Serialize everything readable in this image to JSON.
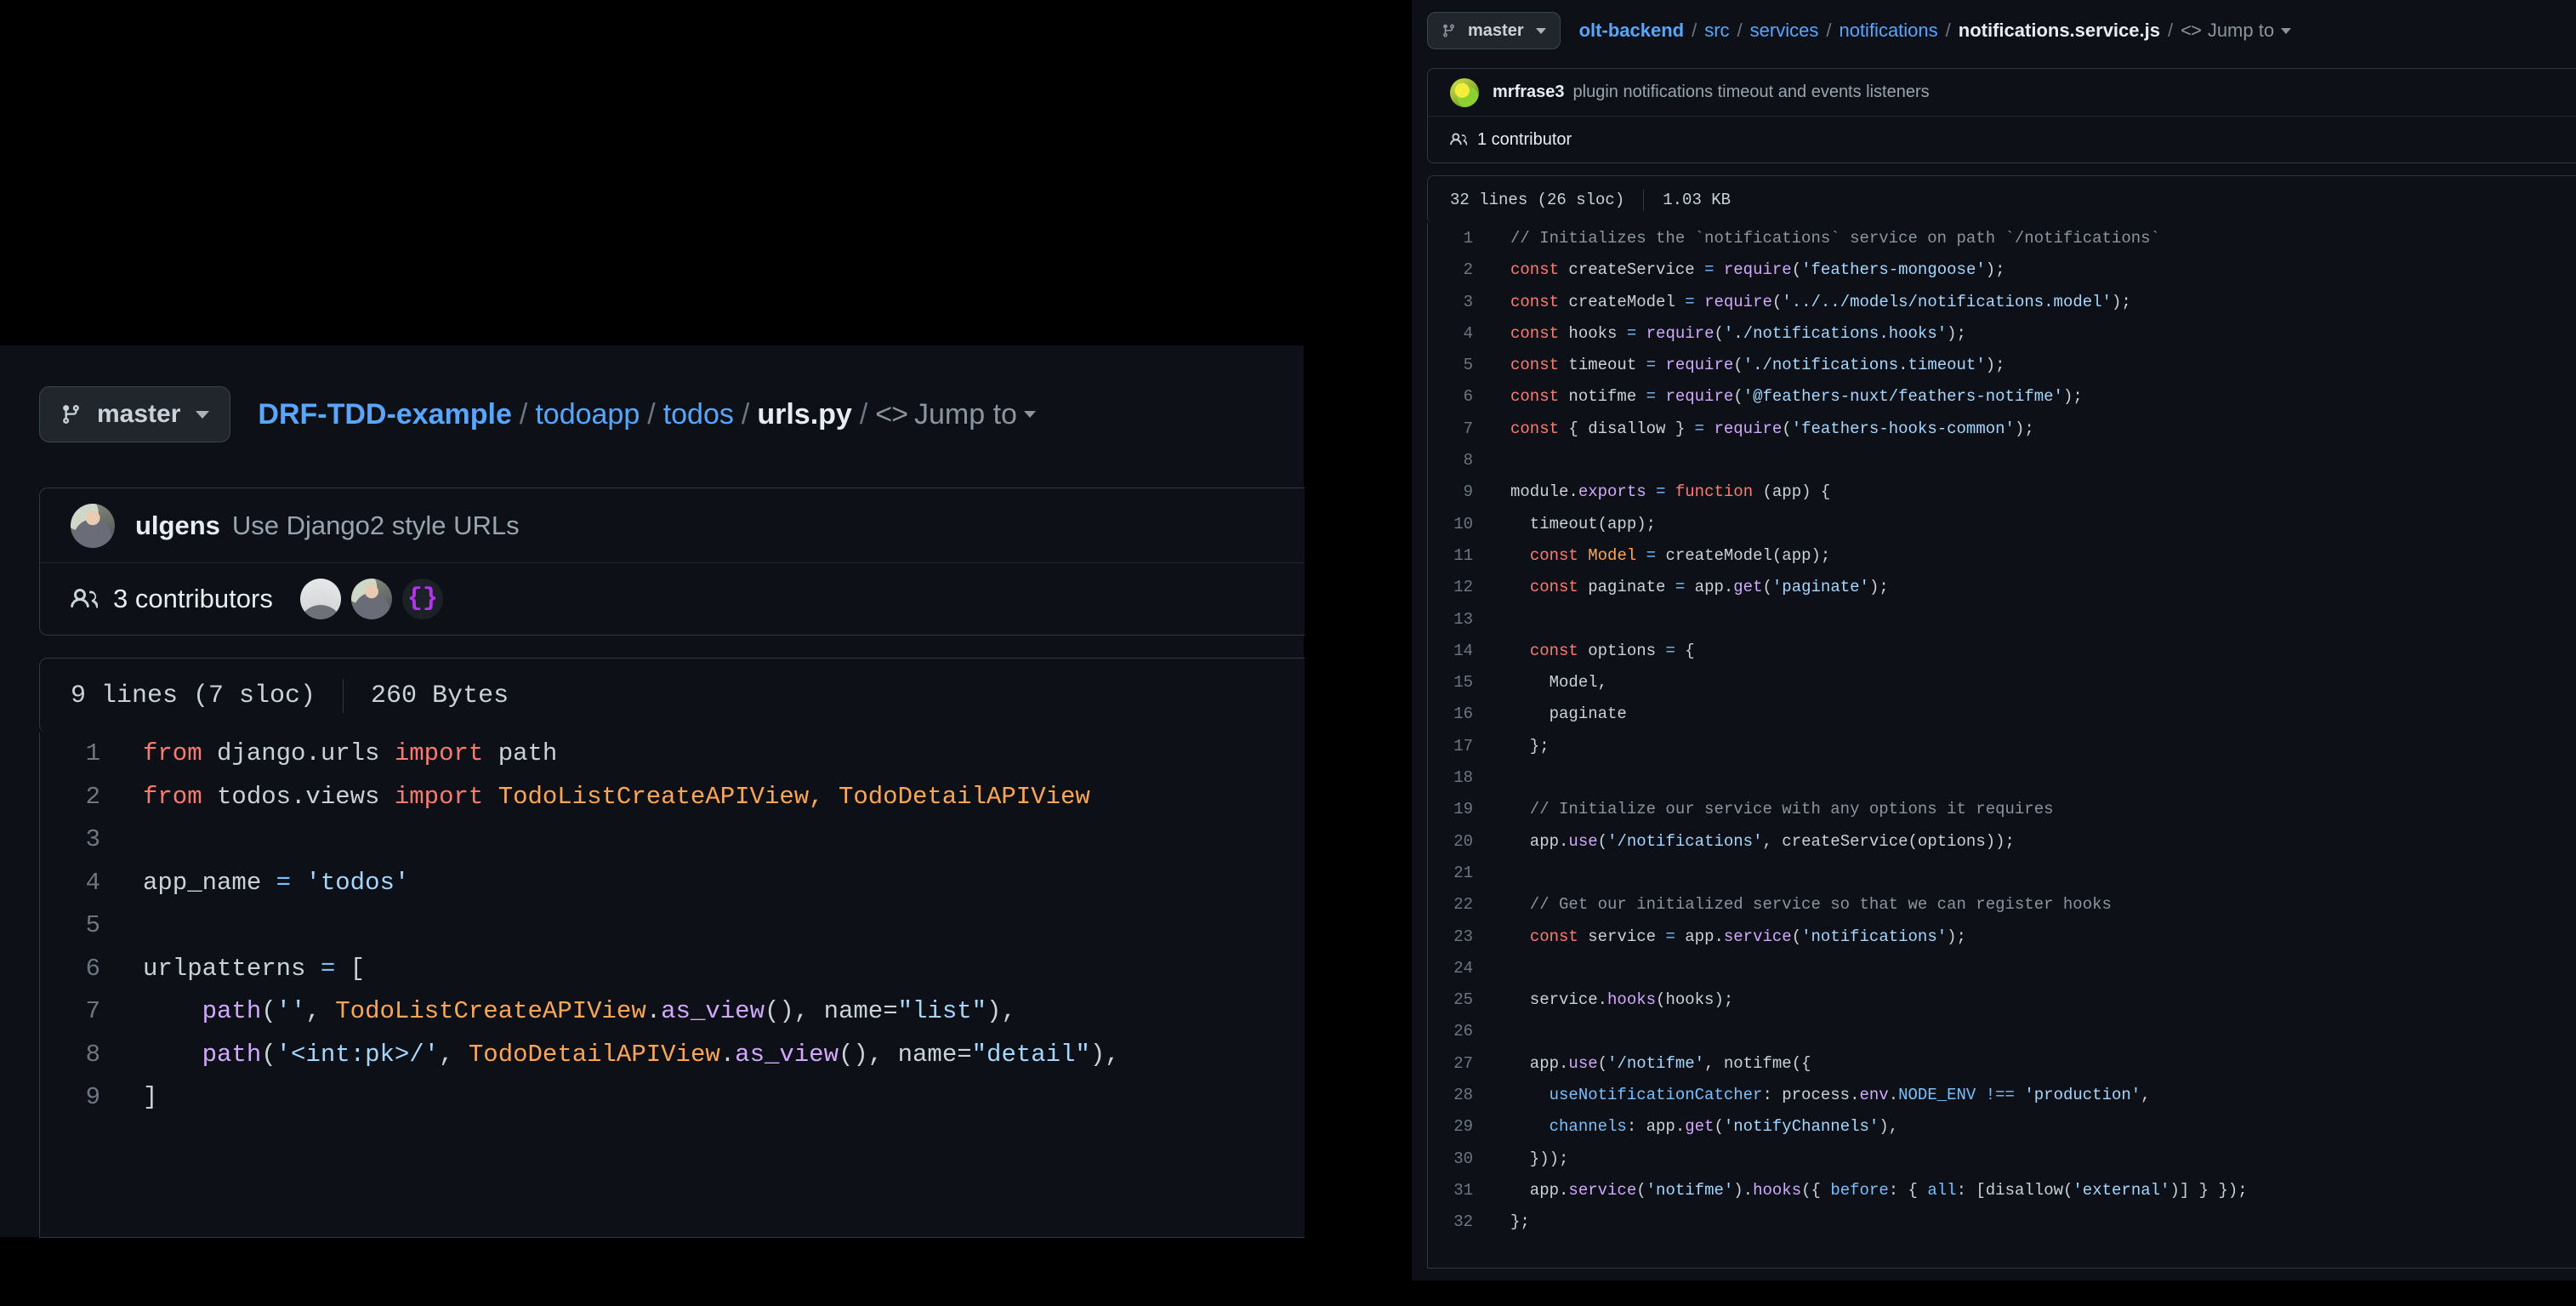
{
  "left_panel": {
    "branch": {
      "label": "master",
      "icon": "git-branch-icon",
      "caret": "▾"
    },
    "breadcrumb": {
      "segments": [
        "DRF-TDD-example",
        "todoapp",
        "todos"
      ],
      "current": "urls.py",
      "separator": "/",
      "jump_to": "Jump to",
      "code_glyph": "<>"
    },
    "commit": {
      "author": "ulgens",
      "message": "Use Django2 style URLs",
      "avatar": "user-avatar-photo"
    },
    "contributors": {
      "count_text": "3 contributors",
      "icon": "people-icon",
      "avatars": [
        "silhouette-avatar",
        "photo-avatar",
        "braces-avatar"
      ],
      "braces_glyph": "{}"
    },
    "file_meta": {
      "lines": "9 lines (7 sloc)",
      "size": "260 Bytes"
    },
    "code": {
      "language": "python",
      "lines": [
        {
          "n": "1",
          "tokens": [
            {
              "t": "from ",
              "c": "t-kw"
            },
            {
              "t": "django.urls ",
              "c": "t-pln"
            },
            {
              "t": "import ",
              "c": "t-kw"
            },
            {
              "t": "path",
              "c": "t-pln"
            }
          ]
        },
        {
          "n": "2",
          "tokens": [
            {
              "t": "from ",
              "c": "t-kw"
            },
            {
              "t": "todos.views ",
              "c": "t-pln"
            },
            {
              "t": "import ",
              "c": "t-kw"
            },
            {
              "t": "TodoListCreateAPIView, TodoDetailAPIView",
              "c": "t-cls"
            }
          ]
        },
        {
          "n": "3",
          "tokens": []
        },
        {
          "n": "4",
          "tokens": [
            {
              "t": "app_name ",
              "c": "t-pln"
            },
            {
              "t": "=",
              "c": "t-op"
            },
            {
              "t": " ",
              "c": "t-pln"
            },
            {
              "t": "'todos'",
              "c": "t-str"
            }
          ]
        },
        {
          "n": "5",
          "tokens": []
        },
        {
          "n": "6",
          "tokens": [
            {
              "t": "urlpatterns ",
              "c": "t-pln"
            },
            {
              "t": "=",
              "c": "t-op"
            },
            {
              "t": " [",
              "c": "t-pln"
            }
          ]
        },
        {
          "n": "7",
          "tokens": [
            {
              "t": "    ",
              "c": "t-pln"
            },
            {
              "t": "path",
              "c": "t-fn"
            },
            {
              "t": "(",
              "c": "t-pln"
            },
            {
              "t": "''",
              "c": "t-str"
            },
            {
              "t": ", ",
              "c": "t-pln"
            },
            {
              "t": "TodoListCreateAPIView",
              "c": "t-cls"
            },
            {
              "t": ".",
              "c": "t-pln"
            },
            {
              "t": "as_view",
              "c": "t-fn"
            },
            {
              "t": "(), name=",
              "c": "t-pln"
            },
            {
              "t": "\"list\"",
              "c": "t-str"
            },
            {
              "t": "),",
              "c": "t-pln"
            }
          ]
        },
        {
          "n": "8",
          "tokens": [
            {
              "t": "    ",
              "c": "t-pln"
            },
            {
              "t": "path",
              "c": "t-fn"
            },
            {
              "t": "(",
              "c": "t-pln"
            },
            {
              "t": "'<int:pk>/'",
              "c": "t-str"
            },
            {
              "t": ", ",
              "c": "t-pln"
            },
            {
              "t": "TodoDetailAPIView",
              "c": "t-cls"
            },
            {
              "t": ".",
              "c": "t-pln"
            },
            {
              "t": "as_view",
              "c": "t-fn"
            },
            {
              "t": "(), name=",
              "c": "t-pln"
            },
            {
              "t": "\"detail\"",
              "c": "t-str"
            },
            {
              "t": "),",
              "c": "t-pln"
            }
          ]
        },
        {
          "n": "9",
          "tokens": [
            {
              "t": "]",
              "c": "t-pln"
            }
          ]
        }
      ]
    }
  },
  "right_panel": {
    "branch": {
      "label": "master",
      "icon": "git-branch-icon",
      "caret": "▾"
    },
    "breadcrumb": {
      "segments": [
        "olt-backend",
        "src",
        "services",
        "notifications"
      ],
      "current": "notifications.service.js",
      "separator": "/",
      "jump_to": "Jump to",
      "code_glyph": "<>"
    },
    "commit": {
      "author": "mrfrase3",
      "message": "plugin notifications timeout and events listeners",
      "avatar": "parrot-avatar"
    },
    "contributors": {
      "count_text": "1 contributor",
      "icon": "people-icon"
    },
    "file_meta": {
      "lines": "32 lines (26 sloc)",
      "size": "1.03 KB"
    },
    "code": {
      "language": "javascript",
      "lines": [
        {
          "n": "1",
          "tokens": [
            {
              "t": "// Initializes the `notifications` service on path `/notifications`",
              "c": "t-cmt"
            }
          ]
        },
        {
          "n": "2",
          "tokens": [
            {
              "t": "const ",
              "c": "t-kw"
            },
            {
              "t": "createService ",
              "c": "t-pln"
            },
            {
              "t": "=",
              "c": "t-op"
            },
            {
              "t": " ",
              "c": "t-pln"
            },
            {
              "t": "require",
              "c": "t-fn"
            },
            {
              "t": "(",
              "c": "t-pln"
            },
            {
              "t": "'feathers-mongoose'",
              "c": "t-str"
            },
            {
              "t": ");",
              "c": "t-pln"
            }
          ]
        },
        {
          "n": "3",
          "tokens": [
            {
              "t": "const ",
              "c": "t-kw"
            },
            {
              "t": "createModel ",
              "c": "t-pln"
            },
            {
              "t": "=",
              "c": "t-op"
            },
            {
              "t": " ",
              "c": "t-pln"
            },
            {
              "t": "require",
              "c": "t-fn"
            },
            {
              "t": "(",
              "c": "t-pln"
            },
            {
              "t": "'../../models/notifications.model'",
              "c": "t-str"
            },
            {
              "t": ");",
              "c": "t-pln"
            }
          ]
        },
        {
          "n": "4",
          "tokens": [
            {
              "t": "const ",
              "c": "t-kw"
            },
            {
              "t": "hooks ",
              "c": "t-pln"
            },
            {
              "t": "=",
              "c": "t-op"
            },
            {
              "t": " ",
              "c": "t-pln"
            },
            {
              "t": "require",
              "c": "t-fn"
            },
            {
              "t": "(",
              "c": "t-pln"
            },
            {
              "t": "'./notifications.hooks'",
              "c": "t-str"
            },
            {
              "t": ");",
              "c": "t-pln"
            }
          ]
        },
        {
          "n": "5",
          "tokens": [
            {
              "t": "const ",
              "c": "t-kw"
            },
            {
              "t": "timeout ",
              "c": "t-pln"
            },
            {
              "t": "=",
              "c": "t-op"
            },
            {
              "t": " ",
              "c": "t-pln"
            },
            {
              "t": "require",
              "c": "t-fn"
            },
            {
              "t": "(",
              "c": "t-pln"
            },
            {
              "t": "'./notifications.timeout'",
              "c": "t-str"
            },
            {
              "t": ");",
              "c": "t-pln"
            }
          ]
        },
        {
          "n": "6",
          "tokens": [
            {
              "t": "const ",
              "c": "t-kw"
            },
            {
              "t": "notifme ",
              "c": "t-pln"
            },
            {
              "t": "=",
              "c": "t-op"
            },
            {
              "t": " ",
              "c": "t-pln"
            },
            {
              "t": "require",
              "c": "t-fn"
            },
            {
              "t": "(",
              "c": "t-pln"
            },
            {
              "t": "'@feathers-nuxt/feathers-notifme'",
              "c": "t-str"
            },
            {
              "t": ");",
              "c": "t-pln"
            }
          ]
        },
        {
          "n": "7",
          "tokens": [
            {
              "t": "const ",
              "c": "t-kw"
            },
            {
              "t": "{ disallow } ",
              "c": "t-pln"
            },
            {
              "t": "=",
              "c": "t-op"
            },
            {
              "t": " ",
              "c": "t-pln"
            },
            {
              "t": "require",
              "c": "t-fn"
            },
            {
              "t": "(",
              "c": "t-pln"
            },
            {
              "t": "'feathers-hooks-common'",
              "c": "t-str"
            },
            {
              "t": ");",
              "c": "t-pln"
            }
          ]
        },
        {
          "n": "8",
          "tokens": []
        },
        {
          "n": "9",
          "tokens": [
            {
              "t": "module.",
              "c": "t-pln"
            },
            {
              "t": "exports",
              "c": "t-fn"
            },
            {
              "t": " ",
              "c": "t-pln"
            },
            {
              "t": "=",
              "c": "t-op"
            },
            {
              "t": " ",
              "c": "t-pln"
            },
            {
              "t": "function",
              "c": "t-kw"
            },
            {
              "t": " (app) {",
              "c": "t-pln"
            }
          ]
        },
        {
          "n": "10",
          "tokens": [
            {
              "t": "  timeout(app);",
              "c": "t-pln"
            }
          ]
        },
        {
          "n": "11",
          "tokens": [
            {
              "t": "  ",
              "c": "t-pln"
            },
            {
              "t": "const ",
              "c": "t-kw"
            },
            {
              "t": "Model",
              "c": "t-cls"
            },
            {
              "t": " ",
              "c": "t-pln"
            },
            {
              "t": "=",
              "c": "t-op"
            },
            {
              "t": " createModel(app);",
              "c": "t-pln"
            }
          ]
        },
        {
          "n": "12",
          "tokens": [
            {
              "t": "  ",
              "c": "t-pln"
            },
            {
              "t": "const ",
              "c": "t-kw"
            },
            {
              "t": "paginate ",
              "c": "t-pln"
            },
            {
              "t": "=",
              "c": "t-op"
            },
            {
              "t": " app.",
              "c": "t-pln"
            },
            {
              "t": "get",
              "c": "t-fn"
            },
            {
              "t": "(",
              "c": "t-pln"
            },
            {
              "t": "'paginate'",
              "c": "t-str"
            },
            {
              "t": ");",
              "c": "t-pln"
            }
          ]
        },
        {
          "n": "13",
          "tokens": []
        },
        {
          "n": "14",
          "tokens": [
            {
              "t": "  ",
              "c": "t-pln"
            },
            {
              "t": "const ",
              "c": "t-kw"
            },
            {
              "t": "options ",
              "c": "t-pln"
            },
            {
              "t": "=",
              "c": "t-op"
            },
            {
              "t": " {",
              "c": "t-pln"
            }
          ]
        },
        {
          "n": "15",
          "tokens": [
            {
              "t": "    Model,",
              "c": "t-pln"
            }
          ]
        },
        {
          "n": "16",
          "tokens": [
            {
              "t": "    paginate",
              "c": "t-pln"
            }
          ]
        },
        {
          "n": "17",
          "tokens": [
            {
              "t": "  };",
              "c": "t-pln"
            }
          ]
        },
        {
          "n": "18",
          "tokens": []
        },
        {
          "n": "19",
          "tokens": [
            {
              "t": "  // Initialize our service with any options it requires",
              "c": "t-cmt"
            }
          ]
        },
        {
          "n": "20",
          "tokens": [
            {
              "t": "  app.",
              "c": "t-pln"
            },
            {
              "t": "use",
              "c": "t-fn"
            },
            {
              "t": "(",
              "c": "t-pln"
            },
            {
              "t": "'/notifications'",
              "c": "t-str"
            },
            {
              "t": ", createService(options));",
              "c": "t-pln"
            }
          ]
        },
        {
          "n": "21",
          "tokens": []
        },
        {
          "n": "22",
          "tokens": [
            {
              "t": "  // Get our initialized service so that we can register hooks",
              "c": "t-cmt"
            }
          ]
        },
        {
          "n": "23",
          "tokens": [
            {
              "t": "  ",
              "c": "t-pln"
            },
            {
              "t": "const ",
              "c": "t-kw"
            },
            {
              "t": "service ",
              "c": "t-pln"
            },
            {
              "t": "=",
              "c": "t-op"
            },
            {
              "t": " app.",
              "c": "t-pln"
            },
            {
              "t": "service",
              "c": "t-fn"
            },
            {
              "t": "(",
              "c": "t-pln"
            },
            {
              "t": "'notifications'",
              "c": "t-str"
            },
            {
              "t": ");",
              "c": "t-pln"
            }
          ]
        },
        {
          "n": "24",
          "tokens": []
        },
        {
          "n": "25",
          "tokens": [
            {
              "t": "  service.",
              "c": "t-pln"
            },
            {
              "t": "hooks",
              "c": "t-fn"
            },
            {
              "t": "(hooks);",
              "c": "t-pln"
            }
          ]
        },
        {
          "n": "26",
          "tokens": []
        },
        {
          "n": "27",
          "tokens": [
            {
              "t": "  app.",
              "c": "t-pln"
            },
            {
              "t": "use",
              "c": "t-fn"
            },
            {
              "t": "(",
              "c": "t-pln"
            },
            {
              "t": "'/notifme'",
              "c": "t-str"
            },
            {
              "t": ", notifme({",
              "c": "t-pln"
            }
          ]
        },
        {
          "n": "28",
          "tokens": [
            {
              "t": "    ",
              "c": "t-pln"
            },
            {
              "t": "useNotificationCatcher",
              "c": "t-var"
            },
            {
              "t": ": process.",
              "c": "t-pln"
            },
            {
              "t": "env",
              "c": "t-fn"
            },
            {
              "t": ".",
              "c": "t-pln"
            },
            {
              "t": "NODE_ENV",
              "c": "t-var"
            },
            {
              "t": " ",
              "c": "t-pln"
            },
            {
              "t": "!==",
              "c": "t-op"
            },
            {
              "t": " ",
              "c": "t-pln"
            },
            {
              "t": "'production'",
              "c": "t-str"
            },
            {
              "t": ",",
              "c": "t-pln"
            }
          ]
        },
        {
          "n": "29",
          "tokens": [
            {
              "t": "    ",
              "c": "t-pln"
            },
            {
              "t": "channels",
              "c": "t-var"
            },
            {
              "t": ": app.",
              "c": "t-pln"
            },
            {
              "t": "get",
              "c": "t-fn"
            },
            {
              "t": "(",
              "c": "t-pln"
            },
            {
              "t": "'notifyChannels'",
              "c": "t-str"
            },
            {
              "t": "),",
              "c": "t-pln"
            }
          ]
        },
        {
          "n": "30",
          "tokens": [
            {
              "t": "  }));",
              "c": "t-pln"
            }
          ]
        },
        {
          "n": "31",
          "tokens": [
            {
              "t": "  app.",
              "c": "t-pln"
            },
            {
              "t": "service",
              "c": "t-fn"
            },
            {
              "t": "(",
              "c": "t-pln"
            },
            {
              "t": "'notifme'",
              "c": "t-str"
            },
            {
              "t": ").",
              "c": "t-pln"
            },
            {
              "t": "hooks",
              "c": "t-fn"
            },
            {
              "t": "({ ",
              "c": "t-pln"
            },
            {
              "t": "before",
              "c": "t-var"
            },
            {
              "t": ": { ",
              "c": "t-pln"
            },
            {
              "t": "all",
              "c": "t-var"
            },
            {
              "t": ": [disallow(",
              "c": "t-pln"
            },
            {
              "t": "'external'",
              "c": "t-str"
            },
            {
              "t": ")] } });",
              "c": "t-pln"
            }
          ]
        },
        {
          "n": "32",
          "tokens": [
            {
              "t": "};",
              "c": "t-pln"
            }
          ]
        }
      ]
    }
  }
}
